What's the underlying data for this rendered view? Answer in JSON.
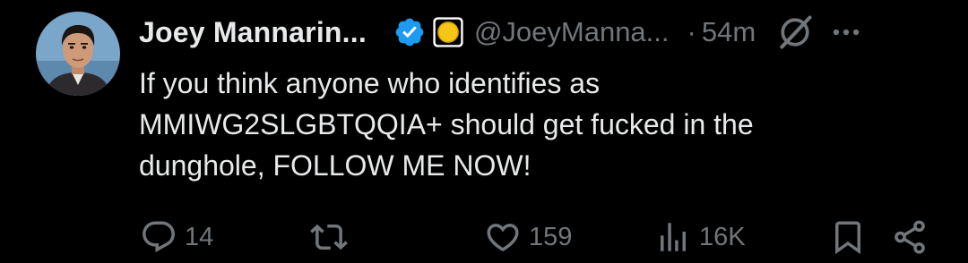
{
  "author": {
    "display_name": "Joey Mannarin...",
    "handle": "@JoeyManna...",
    "time": "54m",
    "dot": "·",
    "verified_color": "#1d9bf0"
  },
  "post": {
    "lines": [
      "If you think anyone who identifies as",
      "MMIWG2SLGBTQQIA+ should get fucked in the",
      "dunghole, FOLLOW ME NOW!"
    ]
  },
  "actions": {
    "reply_count": "14",
    "retweet_count": "",
    "like_count": "159",
    "views_count": "16K"
  },
  "icons": {
    "avatar": "profile-photo",
    "verified": "verified-badge-icon",
    "affiliate": "affiliate-badge-icon",
    "grok": "grok-icon",
    "more": "more-options-icon",
    "reply": "reply-icon",
    "retweet": "retweet-icon",
    "like": "heart-icon",
    "views": "views-chart-icon",
    "bookmark": "bookmark-icon",
    "share": "share-icon"
  },
  "colors": {
    "background": "#000000",
    "text_primary": "#e7e9ea",
    "text_secondary": "#71767b",
    "accent": "#1d9bf0"
  }
}
